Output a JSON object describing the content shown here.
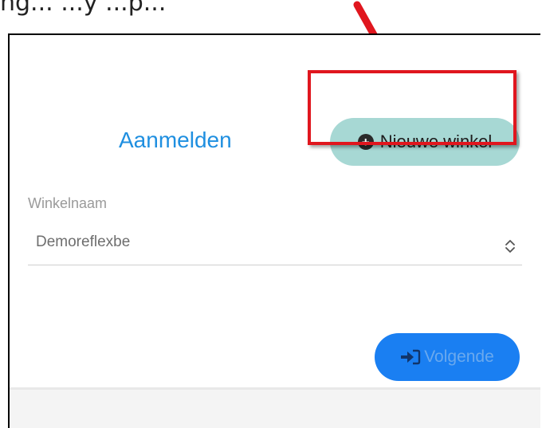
{
  "instruction_text": "...g... ...y... ...p...",
  "login_card": {
    "title": "Aanmelden",
    "new_shop_button": {
      "label": "Nieuwe winkel",
      "icon": "plus-circle-icon"
    },
    "shop_name_label": "Winkelnaam",
    "shop_select": {
      "value": "Demoreflexbe",
      "icon": "up-down-chevron-icon"
    },
    "next_button": {
      "label": "Volgende",
      "icon": "sign-in-icon"
    }
  },
  "annotation": {
    "highlight_color": "#e0161e",
    "arrow_color": "#e0161e"
  },
  "colors": {
    "title": "#1f8fe0",
    "new_shop_button_bg": "#a7d8d4",
    "next_button_bg": "#1a7ff2",
    "next_button_text": "#6aa9ee"
  }
}
